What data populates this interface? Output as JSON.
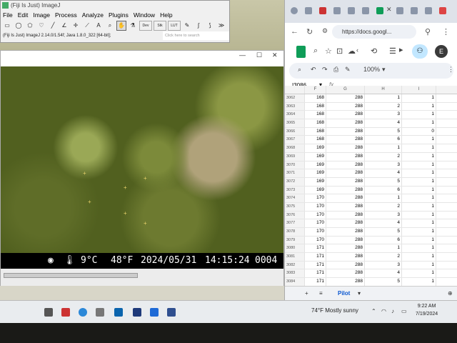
{
  "fiji": {
    "title": "(Fiji Is Just) ImageJ",
    "menu": [
      "File",
      "Edit",
      "Image",
      "Process",
      "Analyze",
      "Plugins",
      "Window",
      "Help"
    ],
    "tools_wide": [
      "Dev",
      "Stk",
      "LUT"
    ],
    "status": "(Fiji Is Just) ImageJ 2.14.0/1.54f; Java 1.8.0_322 [64-bit];",
    "search_placeholder": "Click here to search"
  },
  "overlay": {
    "temp_c": "9°C",
    "temp_f": "48°F",
    "date": "2024/05/31",
    "time": "14:15:24",
    "frame": "0004"
  },
  "browser": {
    "url": "https://docs.googl...",
    "zoom": "100%",
    "avatar_letter": "E",
    "cell_ref": "I3086",
    "fx": "fx"
  },
  "sheet": {
    "columns": [
      "F",
      "G",
      "H",
      "I"
    ],
    "rows": [
      {
        "n": "3062",
        "f": "168",
        "g": "288",
        "h": "1",
        "i": "1"
      },
      {
        "n": "3063",
        "f": "168",
        "g": "288",
        "h": "2",
        "i": "1"
      },
      {
        "n": "3064",
        "f": "168",
        "g": "288",
        "h": "3",
        "i": "1"
      },
      {
        "n": "3065",
        "f": "168",
        "g": "288",
        "h": "4",
        "i": "1"
      },
      {
        "n": "3066",
        "f": "168",
        "g": "288",
        "h": "5",
        "i": "0"
      },
      {
        "n": "3067",
        "f": "168",
        "g": "288",
        "h": "6",
        "i": "1"
      },
      {
        "n": "3068",
        "f": "169",
        "g": "288",
        "h": "1",
        "i": "1"
      },
      {
        "n": "3069",
        "f": "169",
        "g": "288",
        "h": "2",
        "i": "1"
      },
      {
        "n": "3070",
        "f": "169",
        "g": "288",
        "h": "3",
        "i": "1"
      },
      {
        "n": "3071",
        "f": "169",
        "g": "288",
        "h": "4",
        "i": "1"
      },
      {
        "n": "3072",
        "f": "169",
        "g": "288",
        "h": "5",
        "i": "1"
      },
      {
        "n": "3073",
        "f": "169",
        "g": "288",
        "h": "6",
        "i": "1"
      },
      {
        "n": "3074",
        "f": "170",
        "g": "288",
        "h": "1",
        "i": "1"
      },
      {
        "n": "3075",
        "f": "170",
        "g": "288",
        "h": "2",
        "i": "1"
      },
      {
        "n": "3076",
        "f": "170",
        "g": "288",
        "h": "3",
        "i": "1"
      },
      {
        "n": "3077",
        "f": "170",
        "g": "288",
        "h": "4",
        "i": "1"
      },
      {
        "n": "3078",
        "f": "170",
        "g": "288",
        "h": "5",
        "i": "1"
      },
      {
        "n": "3079",
        "f": "170",
        "g": "288",
        "h": "6",
        "i": "1"
      },
      {
        "n": "3080",
        "f": "171",
        "g": "288",
        "h": "1",
        "i": "1"
      },
      {
        "n": "3081",
        "f": "171",
        "g": "288",
        "h": "2",
        "i": "1"
      },
      {
        "n": "3082",
        "f": "171",
        "g": "288",
        "h": "3",
        "i": "1"
      },
      {
        "n": "3083",
        "f": "171",
        "g": "288",
        "h": "4",
        "i": "1"
      },
      {
        "n": "3084",
        "f": "171",
        "g": "288",
        "h": "5",
        "i": "1"
      },
      {
        "n": "3085",
        "f": "171",
        "g": "288",
        "h": "6",
        "i": "1"
      },
      {
        "n": "3086",
        "f": "172",
        "g": "288",
        "h": "1",
        "i": ""
      }
    ],
    "selected_row": "3086",
    "tab_name": "Pilot"
  },
  "taskbar": {
    "weather": "74°F  Mostly sunny",
    "time": "9:22 AM",
    "date": "7/19/2024"
  }
}
